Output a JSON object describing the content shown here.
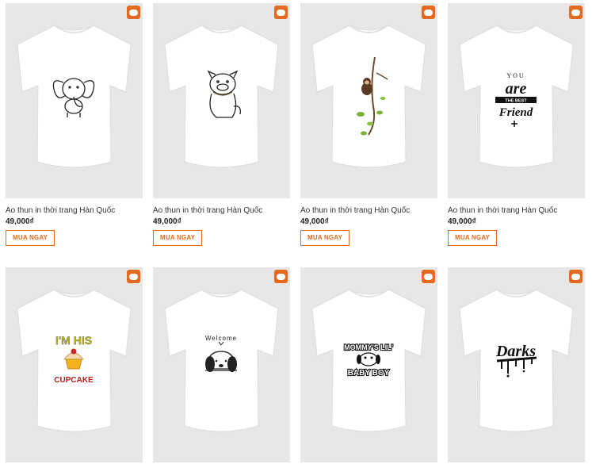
{
  "products": [
    {
      "name": "Áo thun in thời trang Hàn Quốc",
      "price": "49,000₫",
      "button": "MUA NGAY",
      "design": "elephant-print"
    },
    {
      "name": "Áo thun in thời trang Hàn Quốc",
      "price": "49,000₫",
      "button": "MUA NGAY",
      "design": "bulldog-print"
    },
    {
      "name": "Áo thun in thời trang Hàn Quốc",
      "price": "49,000₫",
      "button": "MUA NGAY",
      "design": "monkey-vine-print"
    },
    {
      "name": "Áo thun in thời trang Hàn Quốc",
      "price": "49,000₫",
      "button": "MUA NGAY",
      "design": "you-are-the-best-friend-print",
      "print_text": {
        "line1": "YOU",
        "line2": "are",
        "line3": "THE BEST",
        "line4": "Friend"
      }
    },
    {
      "design": "im-his-cupcake-print",
      "print_text": {
        "line1": "I'M HIS",
        "line2": "CUPCAKE"
      }
    },
    {
      "design": "welcome-puppy-print",
      "print_text": {
        "line1": "Welcome"
      }
    },
    {
      "design": "mommys-lil-baby-boy-print",
      "print_text": {
        "line1": "MOMMY'S LIL'",
        "line2": "BABY BOY"
      }
    },
    {
      "design": "dark-graffiti-print",
      "print_text": {
        "line1": "Darks"
      }
    }
  ],
  "colors": {
    "accent": "#e36a1e",
    "thumb_bg": "#e9e7e5"
  }
}
